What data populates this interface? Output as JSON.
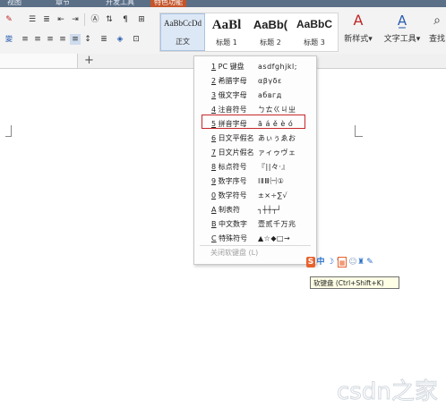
{
  "menu_tabs": [
    "视图",
    "章节",
    "开发工具",
    "特色功能"
  ],
  "styles_gallery": [
    {
      "sample": "AaBbCcDd",
      "name": "正文",
      "size": 9,
      "bold": false
    },
    {
      "sample": "AaBl",
      "name": "标题 1",
      "size": 15,
      "bold": true
    },
    {
      "sample": "AaBb(",
      "name": "标题 2",
      "size": 13,
      "bold": true
    },
    {
      "sample": "AaBbC",
      "name": "标题 3",
      "size": 12,
      "bold": true
    }
  ],
  "ribbon": {
    "new_style_label": "新样式",
    "text_tools_label": "文字工具",
    "find_label": "查找"
  },
  "tabstrip": {
    "add_tab": "+"
  },
  "soft_keyboard_menu": {
    "items": [
      {
        "key": "1",
        "label": "PC 键盘",
        "sample": "asdfghjkl;"
      },
      {
        "key": "2",
        "label": "希腊字母",
        "sample": "αβγδε"
      },
      {
        "key": "3",
        "label": "俄文字母",
        "sample": "абвгд"
      },
      {
        "key": "4",
        "label": "注音符号",
        "sample": "ㄅㄊㄍㄐㄓ"
      },
      {
        "key": "5",
        "label": "拼音字母",
        "sample": "ā á ě è ó"
      },
      {
        "key": "6",
        "label": "日文平假名",
        "sample": "あぃぅゑお"
      },
      {
        "key": "7",
        "label": "日文片假名",
        "sample": "ァィゥヴェ"
      },
      {
        "key": "8",
        "label": "标点符号",
        "sample": "『||々·』"
      },
      {
        "key": "9",
        "label": "数字序号",
        "sample": "ⅠⅡⅢ㈠①"
      },
      {
        "key": "0",
        "label": "数学符号",
        "sample": "±×÷∑√"
      },
      {
        "key": "A",
        "label": "制表符",
        "sample": "┐┼┼┬┘"
      },
      {
        "key": "B",
        "label": "中文数字",
        "sample": "壹贰千万兆"
      },
      {
        "key": "C",
        "label": "特殊符号",
        "sample": "▲☆◆□→"
      }
    ],
    "highlighted_index": 4,
    "close_label": "关闭软键盘 (L)"
  },
  "ime_bar": {
    "tooltip": "软键盘 (Ctrl+Shift+K)"
  },
  "watermark": "csdn之家",
  "colors": {
    "highlight_border": "#c8272b",
    "menubar_bg": "#5b6f86",
    "ime_orange": "#e8612c",
    "ime_blue": "#2a6fc9"
  }
}
